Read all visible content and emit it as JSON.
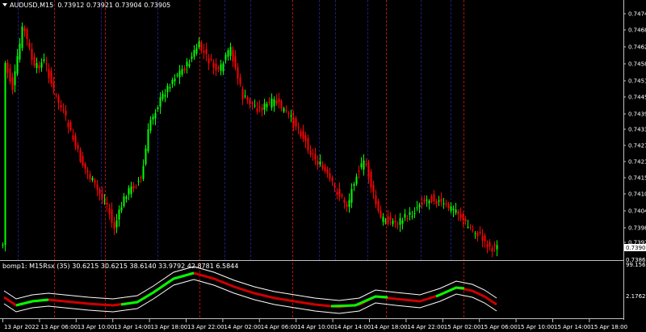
{
  "main_chart": {
    "symbol_timeframe": "AUDUSD,M15",
    "ohlc": "0.73912 0.73921 0.73904 0.73905",
    "price_ticks": [
      "0.74745",
      "0.74685",
      "0.74625",
      "0.74580",
      "0.74510",
      "0.74450",
      "0.74390",
      "0.74335",
      "0.74275",
      "0.74215",
      "0.74155",
      "0.74100",
      "0.74040",
      "0.73980",
      "0.73920"
    ],
    "current_price": "0.73905",
    "bottom_price": "0.73865",
    "colors": {
      "background": "#000000",
      "bull": "#00ff00",
      "bear": "#ff0000",
      "grid": "#7f7f7f"
    }
  },
  "indicator": {
    "label": "bomp1: M15Rsx (35) 30.6215 30.6215 38.6140 33.9792 42.8781 6.5844",
    "top_value": "99.1569",
    "bottom_value": "2.1762",
    "colors": {
      "line_up": "#00ff00",
      "line_down": "#cc0000",
      "band": "#ffffff"
    }
  },
  "time_axis": {
    "labels": [
      "13 Apr 2022",
      "13 Apr 06:00",
      "13 Apr 10:00",
      "13 Apr 14:00",
      "13 Apr 18:00",
      "13 Apr 22:00",
      "14 Apr 02:00",
      "14 Apr 06:00",
      "14 Apr 10:00",
      "14 Apr 14:00",
      "14 Apr 18:00",
      "14 Apr 22:00",
      "15 Apr 02:00",
      "15 Apr 06:00",
      "15 Apr 10:00",
      "15 Apr 14:00",
      "15 Apr 18:00"
    ]
  }
}
